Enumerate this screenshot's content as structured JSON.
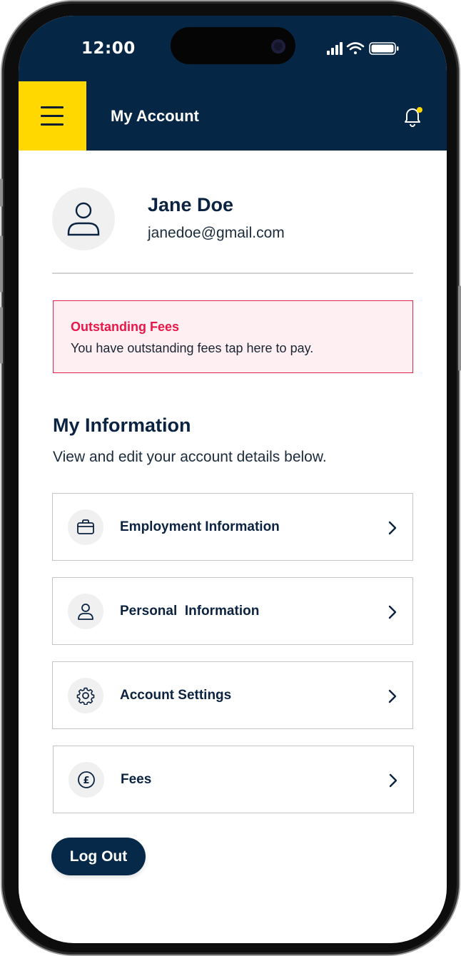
{
  "status_bar": {
    "time": "12:00"
  },
  "header": {
    "title": "My Account",
    "menu_icon": "hamburger-icon",
    "notification_icon": "bell-icon"
  },
  "profile": {
    "name": "Jane Doe",
    "email": "janedoe@gmail.com",
    "avatar_icon": "user-icon"
  },
  "alert": {
    "title": "Outstanding Fees",
    "message": "You have outstanding fees tap here to pay."
  },
  "section": {
    "title": "My Information",
    "subtitle": "View and edit your account details below."
  },
  "cards": [
    {
      "label": "Employment Information",
      "icon": "briefcase-icon"
    },
    {
      "label": "Personal  Information",
      "icon": "user-icon"
    },
    {
      "label": "Account Settings",
      "icon": "gear-icon"
    },
    {
      "label": "Fees",
      "icon": "pound-icon"
    }
  ],
  "logout": {
    "label": "Log Out"
  },
  "colors": {
    "brand_navy": "#052644",
    "accent_yellow": "#ffd800",
    "alert_red": "#e8174a",
    "alert_bg": "#fdeff2",
    "notification_dot": "#ffd800"
  }
}
